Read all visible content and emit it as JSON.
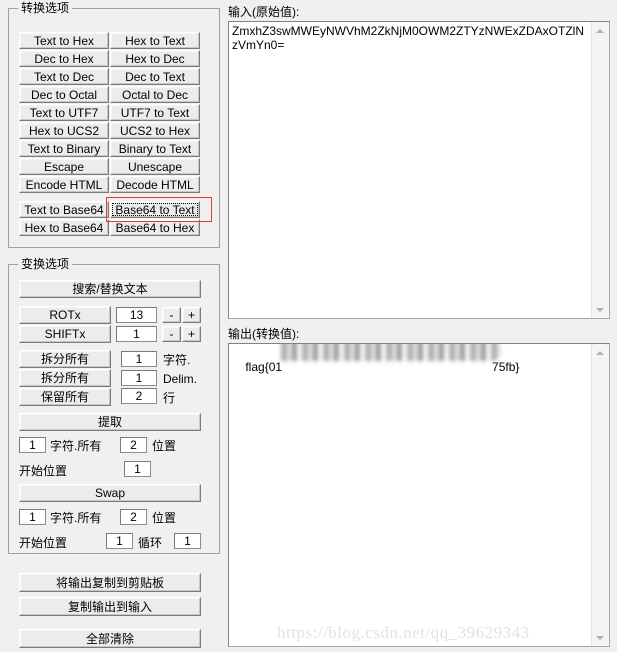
{
  "conversion_group": {
    "title": "转换选项",
    "buttons": [
      {
        "left": "Text to Hex",
        "right": "Hex to Text"
      },
      {
        "left": "Dec to Hex",
        "right": "Hex to Dec"
      },
      {
        "left": "Text to Dec",
        "right": "Dec to Text"
      },
      {
        "left": "Dec to Octal",
        "right": "Octal to Dec"
      },
      {
        "left": "Text to UTF7",
        "right": "UTF7 to Text"
      },
      {
        "left": "Hex to UCS2",
        "right": "UCS2 to Hex"
      },
      {
        "left": "Text to Binary",
        "right": "Binary to Text"
      },
      {
        "left": "Escape",
        "right": "Unescape"
      },
      {
        "left": "Encode HTML",
        "right": "Decode HTML"
      }
    ],
    "base64_buttons": [
      {
        "left": "Text to Base64",
        "right": "Base64 to Text"
      },
      {
        "left": "Hex to Base64",
        "right": "Base64 to Hex"
      }
    ],
    "focused_button": "Base64 to Text"
  },
  "transform_group": {
    "title": "变换选项",
    "search_replace_label": "搜索/替换文本",
    "rot": {
      "label": "ROTx",
      "value": "13",
      "minus": "-",
      "plus": "+"
    },
    "shift": {
      "label": "SHIFTx",
      "value": "1",
      "minus": "-",
      "plus": "+"
    },
    "split_chars": {
      "label": "拆分所有",
      "value": "1",
      "unit": "字符."
    },
    "split_delim": {
      "label": "拆分所有",
      "value": "1",
      "unit": "Delim."
    },
    "keep_lines": {
      "label": "保留所有",
      "value": "2",
      "unit": "行"
    },
    "extract": {
      "button": "提取",
      "chars_value": "1",
      "chars_label": "字符.所有",
      "pos_value": "2",
      "pos_label": "位置",
      "start_label": "开始位置",
      "start_value": "1"
    },
    "swap": {
      "button": "Swap",
      "chars_value": "1",
      "chars_label": "字符.所有",
      "pos_value": "2",
      "pos_label": "位置",
      "start_label": "开始位置",
      "start_value": "1",
      "loop_label": "循环",
      "loop_value": "1"
    }
  },
  "actions": {
    "copy_output_to_clipboard": "将输出复制到剪贴板",
    "copy_output_to_input": "复制输出到输入",
    "clear_all": "全部清除"
  },
  "input_panel": {
    "label": "输入(原始值):",
    "value": "ZmxhZ3swMWEyNWVhM2ZkNjM0OWM2ZTYzNWExZDAxOTZlNzVmYn0="
  },
  "output_panel": {
    "label": "输出(转换值):",
    "value_prefix": "flag{01",
    "value_suffix": "75fb}",
    "redacted": true
  },
  "watermark": "https://blog.csdn.net/qq_39629343",
  "colors": {
    "background": "#f0f0f0",
    "button_face": "#ececec",
    "annotation": "#e53935",
    "watermark": "#e2e2e2"
  }
}
